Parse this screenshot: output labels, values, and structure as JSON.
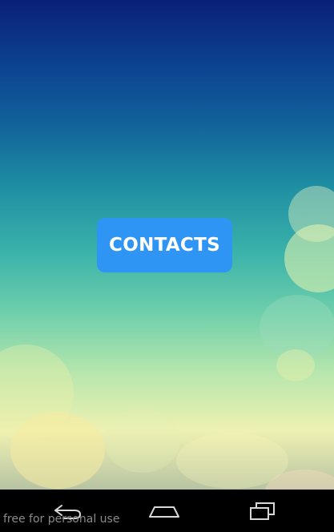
{
  "main": {
    "contacts_button_label": "CONTACTS"
  },
  "footer": {
    "watermark_text": "free for personal use"
  },
  "navbar": {
    "back_icon": "back-icon",
    "home_icon": "home-icon",
    "recents_icon": "recents-icon"
  },
  "colors": {
    "button_background": "#2f95f5",
    "button_text": "#ffffff",
    "navbar_background": "#000000"
  }
}
